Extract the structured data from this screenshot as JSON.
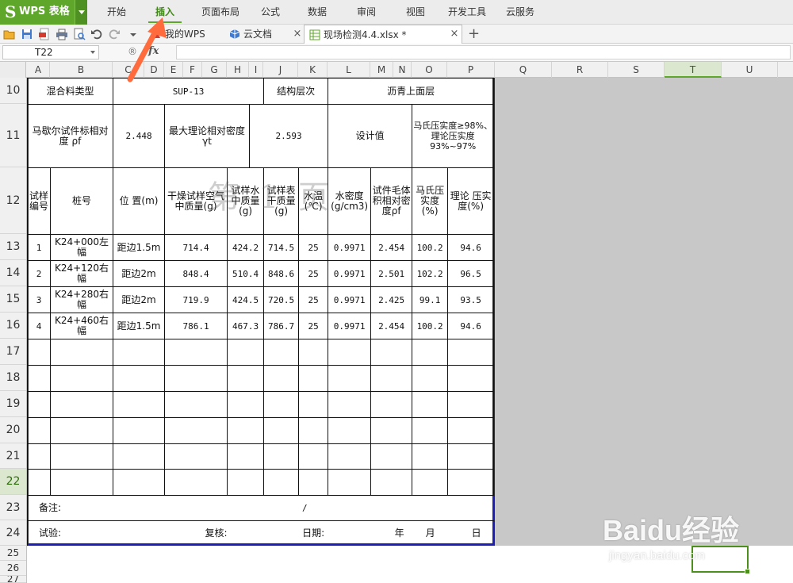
{
  "app": {
    "logo_mark": "S",
    "logo_text": "WPS 表格"
  },
  "menu": {
    "items": [
      {
        "label": "开始"
      },
      {
        "label": "插入",
        "active": true
      },
      {
        "label": "页面布局"
      },
      {
        "label": "公式"
      },
      {
        "label": "数据"
      },
      {
        "label": "审阅"
      },
      {
        "label": "视图"
      },
      {
        "label": "开发工具"
      },
      {
        "label": "云服务"
      }
    ]
  },
  "tabs": {
    "my_wps": "我的WPS",
    "cloud_docs": "云文档",
    "active_file": "现场检测4.4.xlsx *",
    "close_glyph": "×",
    "new_tab_glyph": "+"
  },
  "formula_bar": {
    "cell_ref": "T22",
    "zoom_glyph": "®",
    "fx_label": "fx",
    "content": ""
  },
  "columns": [
    "A",
    "B",
    "C",
    "D",
    "E",
    "F",
    "G",
    "H",
    "I",
    "J",
    "K",
    "L",
    "M",
    "N",
    "O",
    "P",
    "Q",
    "R",
    "S",
    "T",
    "U"
  ],
  "selected_column": "T",
  "rows": [
    "10",
    "11",
    "12",
    "13",
    "14",
    "15",
    "16",
    "17",
    "18",
    "19",
    "20",
    "21",
    "22",
    "23",
    "24",
    "25",
    "26",
    "27"
  ],
  "selected_row": "22",
  "sheet": {
    "row10": {
      "mix_type_label": "混合料类型",
      "mix_type_value": "SUP-13",
      "layer_label": "结构层次",
      "layer_value": "沥青上面层"
    },
    "row11": {
      "marshall_label": "马歇尔试件标相对度 ρf",
      "marshall_value": "2.448",
      "max_density_label": "最大理论相对密度 γt",
      "max_density_value": "2.593",
      "design_label": "设计值",
      "design_value": "马氏压实度≥98%、理论压实度93%~97%"
    },
    "headers": {
      "sample_no": "试样编号",
      "station": "桩号",
      "position": "位 置(m)",
      "dry_mass_air": "干燥试样空气中质量(g)",
      "mass_in_water": "试样水中质量(g)",
      "saturated_mass": "试样表干质量(g)",
      "water_temp": "水温(℃)",
      "water_density": "水密度(g/cm3)",
      "bulk_density": "试件毛体积相对密度ρf",
      "marshall_compaction": "马氏压实度(%)",
      "theory_compaction": "理论 压实度(%)"
    },
    "data_rows": [
      {
        "no": "1",
        "station": "K24+000左幅",
        "position": "距边1.5m",
        "dry": "714.4",
        "water": "424.2",
        "sat": "714.5",
        "temp": "25",
        "wd": "0.9971",
        "bulk": "2.454",
        "mc": "100.2",
        "tc": "94.6"
      },
      {
        "no": "2",
        "station": "K24+120右幅",
        "position": "距边2m",
        "dry": "848.4",
        "water": "510.4",
        "sat": "848.6",
        "temp": "25",
        "wd": "0.9971",
        "bulk": "2.501",
        "mc": "102.2",
        "tc": "96.5"
      },
      {
        "no": "3",
        "station": "K24+280右幅",
        "position": "距边2m",
        "dry": "719.9",
        "water": "424.5",
        "sat": "720.5",
        "temp": "25",
        "wd": "0.9971",
        "bulk": "2.425",
        "mc": "99.1",
        "tc": "93.5"
      },
      {
        "no": "4",
        "station": "K24+460右幅",
        "position": "距边1.5m",
        "dry": "786.1",
        "water": "467.3",
        "sat": "786.7",
        "temp": "25",
        "wd": "0.9971",
        "bulk": "2.454",
        "mc": "100.2",
        "tc": "94.6"
      }
    ],
    "notes_label": "备注:",
    "notes_slash": "/",
    "footer": {
      "test": "试验:",
      "review": "复核:",
      "date": "日期:",
      "year": "年",
      "month": "月",
      "day": "日"
    },
    "watermark": "第1页"
  },
  "baidu": {
    "brand": "Baidu经验",
    "url": "jingyan.baidu.com"
  },
  "colors": {
    "wps_green": "#5fa72a",
    "print_border": "#1d1db8",
    "annotation_red": "#ff6b3d"
  }
}
